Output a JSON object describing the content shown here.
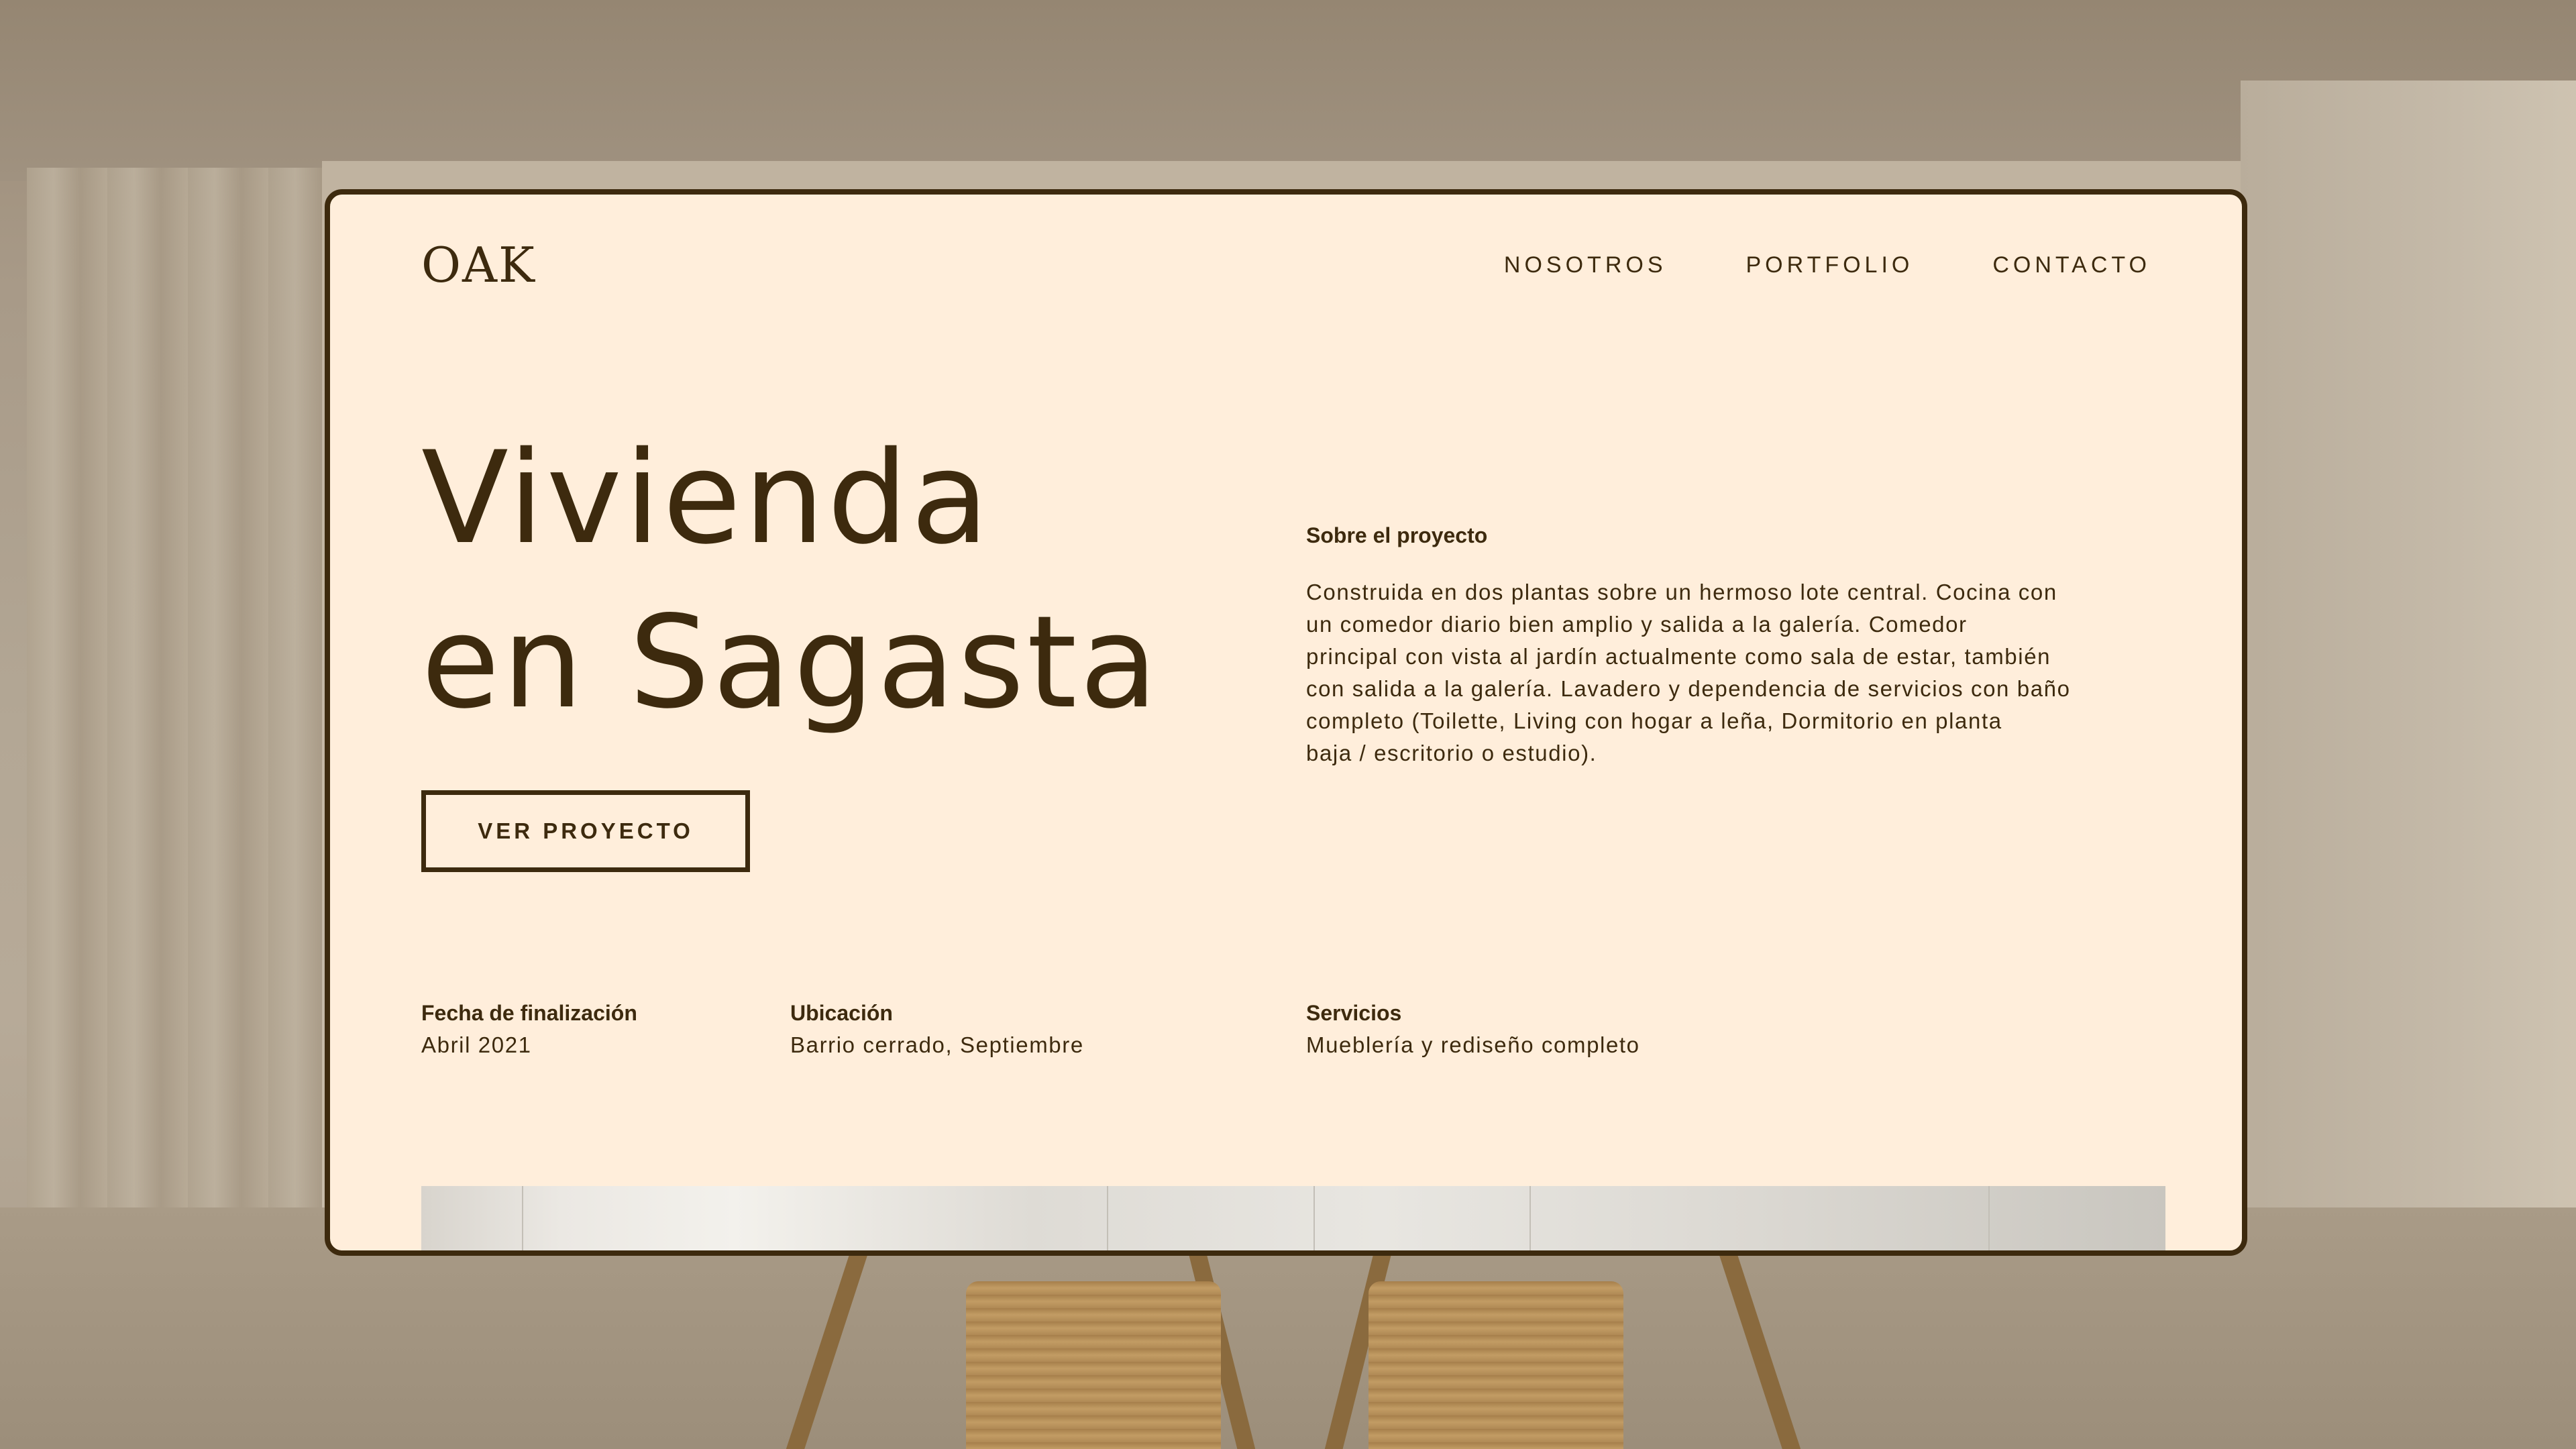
{
  "colors": {
    "panel_background": "#ffeedb",
    "text": "#3d2a0e",
    "border": "#3d2a0e"
  },
  "brand": {
    "logo": "OAK"
  },
  "nav": {
    "items": [
      {
        "label": "NOSOTROS"
      },
      {
        "label": "PORTFOLIO"
      },
      {
        "label": "CONTACTO"
      }
    ]
  },
  "hero": {
    "title_line1": "Vivienda",
    "title_line2": "en Sagasta",
    "cta_label": "VER PROYECTO"
  },
  "about": {
    "heading": "Sobre el proyecto",
    "lines": [
      "Construida en dos plantas sobre un hermoso lote central. Cocina con",
      "un comedor diario bien amplio y salida a la galería. Comedor",
      "principal con vista al jardín actualmente como sala de estar, también",
      "con salida a la galería. Lavadero y dependencia de servicios con baño",
      "completo (Toilette, Living con hogar a leña, Dormitorio en planta",
      "baja / escritorio o estudio)."
    ]
  },
  "details": {
    "date": {
      "label": "Fecha de finalización",
      "value": "Abril 2021"
    },
    "location": {
      "label": "Ubicación",
      "value": "Barrio cerrado, Septiembre"
    },
    "services": {
      "label": "Servicios",
      "value": "Mueblería y rediseño completo"
    }
  }
}
